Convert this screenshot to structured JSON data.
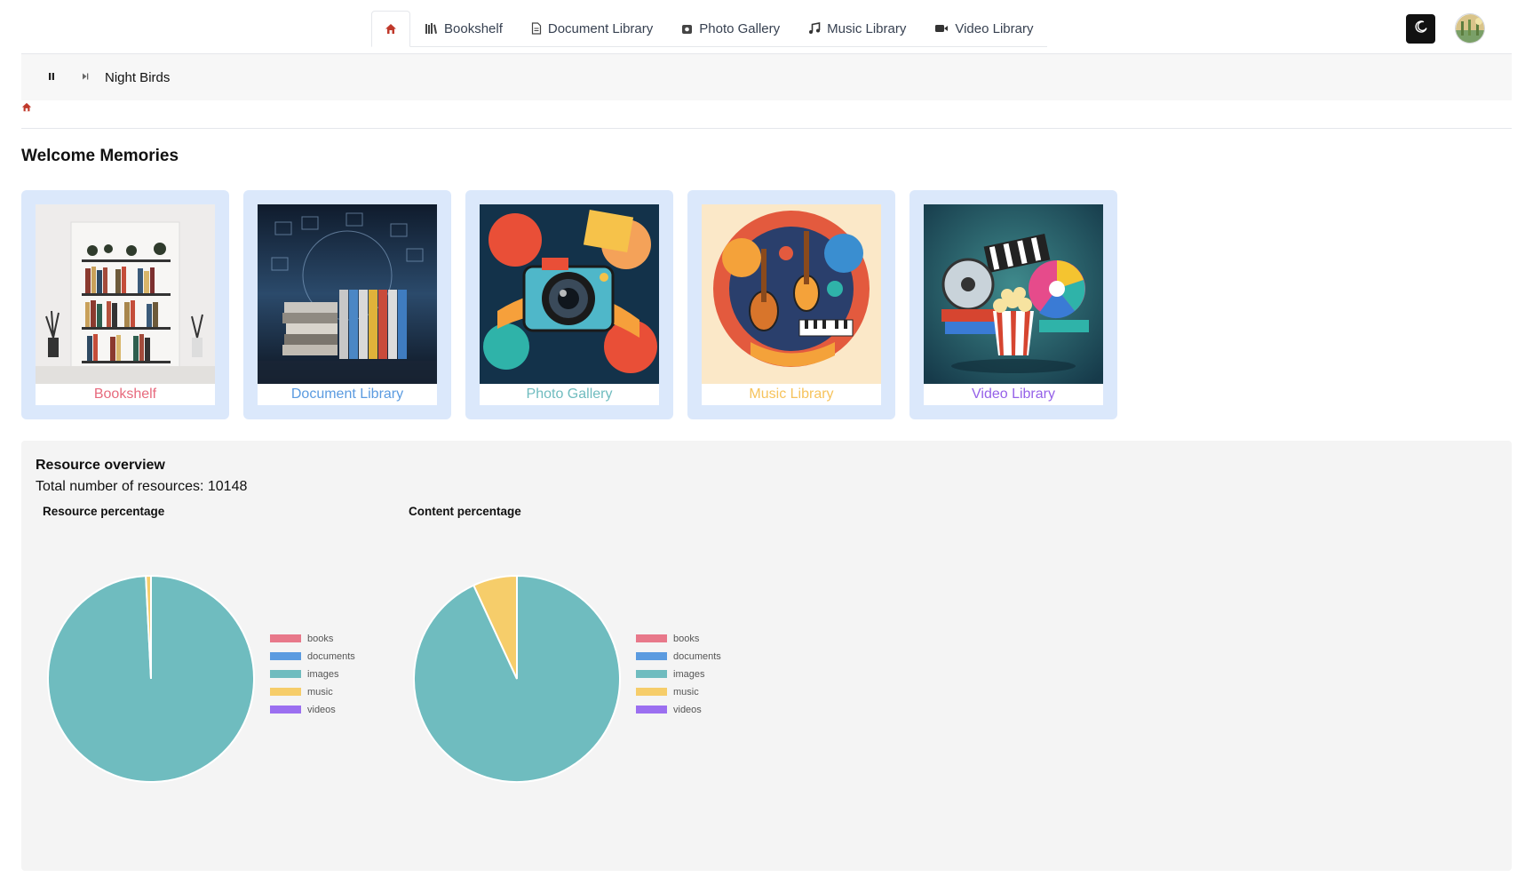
{
  "nav": {
    "tabs": [
      {
        "label": "",
        "icon": "home-icon"
      },
      {
        "label": "Bookshelf",
        "icon": "books-icon"
      },
      {
        "label": "Document Library",
        "icon": "document-icon"
      },
      {
        "label": "Photo Gallery",
        "icon": "photo-icon"
      },
      {
        "label": "Music Library",
        "icon": "music-note-icon"
      },
      {
        "label": "Video Library",
        "icon": "video-camera-icon"
      }
    ]
  },
  "player": {
    "track": "Night Birds"
  },
  "page": {
    "title": "Welcome Memories"
  },
  "cards": [
    {
      "label": "Bookshelf",
      "color": "#e76a7d"
    },
    {
      "label": "Document Library",
      "color": "#5b9be0"
    },
    {
      "label": "Photo Gallery",
      "color": "#6fbcbf"
    },
    {
      "label": "Music Library",
      "color": "#f6c35c"
    },
    {
      "label": "Video Library",
      "color": "#9561e8"
    }
  ],
  "overview": {
    "title": "Resource overview",
    "total_label": "Total number of resources: 10148"
  },
  "chart_data": [
    {
      "type": "pie",
      "title": "Resource percentage",
      "categories": [
        "books",
        "documents",
        "images",
        "music",
        "videos"
      ],
      "values": [
        0,
        0,
        99.2,
        0.8,
        0
      ],
      "colors": [
        "#e8788a",
        "#5b9be0",
        "#6fbcbf",
        "#f6cd6a",
        "#9b6ff0"
      ],
      "legend": "right"
    },
    {
      "type": "pie",
      "title": "Content percentage",
      "categories": [
        "books",
        "documents",
        "images",
        "music",
        "videos"
      ],
      "values": [
        0,
        0,
        93.1,
        6.9,
        0
      ],
      "colors": [
        "#e8788a",
        "#5b9be0",
        "#6fbcbf",
        "#f6cd6a",
        "#9b6ff0"
      ],
      "legend": "right"
    }
  ]
}
